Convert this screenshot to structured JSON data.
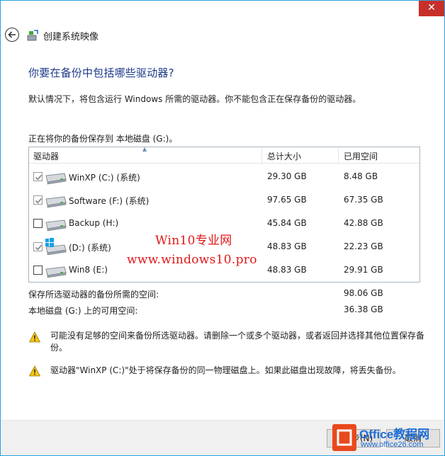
{
  "window": {
    "close_label": "✕"
  },
  "nav": {
    "title": "创建系统映像"
  },
  "heading": "你要在备份中包括哪些驱动器?",
  "description": "默认情况下，将包含运行 Windows 所需的驱动器。你不能包含正在保存备份的驱动器。",
  "saving_to": "正在将你的备份保存到 本地磁盘 (G:)。",
  "table": {
    "columns": [
      "驱动器",
      "总计大小",
      "已用空间"
    ],
    "rows": [
      {
        "name": "WinXP (C:) (系统)",
        "total": "29.30 GB",
        "used": "8.48 GB",
        "checked": true,
        "disabled": true,
        "icon": "hard-drive-icon"
      },
      {
        "name": "Software (F:) (系统)",
        "total": "97.65 GB",
        "used": "67.35 GB",
        "checked": true,
        "disabled": true,
        "icon": "hard-drive-icon"
      },
      {
        "name": "Backup (H:)",
        "total": "45.84 GB",
        "used": "42.88 GB",
        "checked": false,
        "disabled": false,
        "icon": "hard-drive-icon"
      },
      {
        "name": "(D:) (系统)",
        "total": "48.83 GB",
        "used": "22.23 GB",
        "checked": true,
        "disabled": true,
        "icon": "windows-drive-icon"
      },
      {
        "name": "Win8 (E:)",
        "total": "48.83 GB",
        "used": "29.91 GB",
        "checked": false,
        "disabled": false,
        "icon": "hard-drive-icon"
      }
    ]
  },
  "summary": {
    "required_label": "保存所选驱动器的备份所需的空间:",
    "required_value": "98.06 GB",
    "available_label": "本地磁盘 (G:) 上的可用空间:",
    "available_value": "36.38 GB"
  },
  "warnings": [
    "可能没有足够的空间来备份所选驱动器。请删除一个或多个驱动器，或者返回并选择其他位置保存备份。",
    "驱动器\"WinXP (C:)\"处于将保存备份的同一物理磁盘上。如果此磁盘出现故障，将丢失备份。"
  ],
  "footer": {
    "next_label": "下一步(N)",
    "cancel_label": "取消"
  },
  "watermarks": {
    "line1": "Win10专业网",
    "line2": "www.windows10.pro",
    "office_name": "Office教程网",
    "office_url": "www.office26.com"
  },
  "colors": {
    "accent_border": "#29a3e2",
    "heading": "#1e3a8a",
    "close": "#c7302a",
    "watermark": "#e01818",
    "office_badge": "#e8491d"
  }
}
